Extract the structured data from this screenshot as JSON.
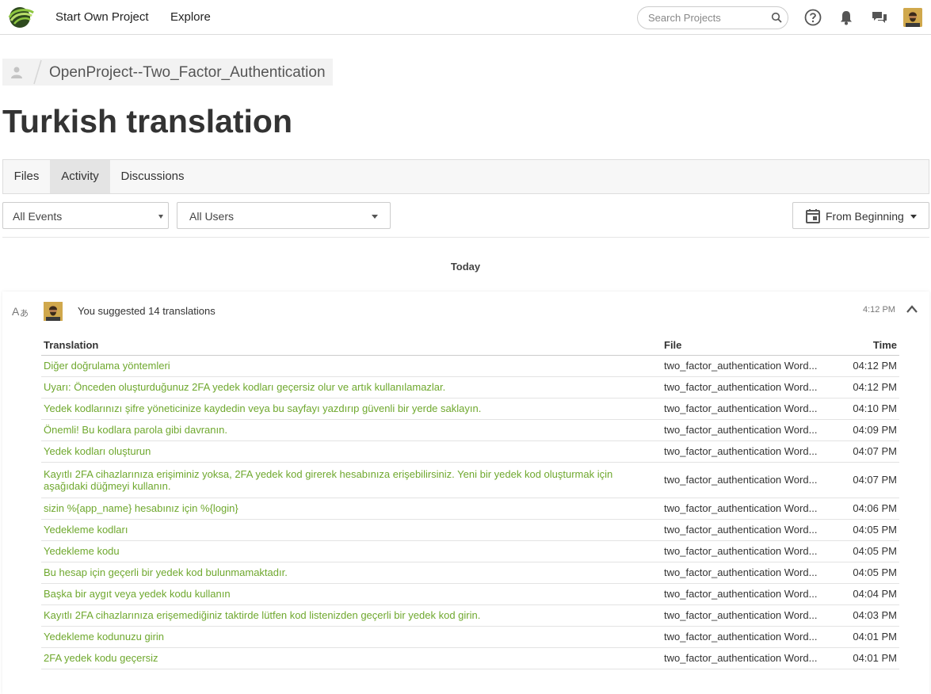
{
  "nav": {
    "start_project": "Start Own Project",
    "explore": "Explore",
    "search_placeholder": "Search Projects"
  },
  "breadcrumb": {
    "project": "OpenProject--Two_Factor_Authentication"
  },
  "page_title": "Turkish translation",
  "tabs": [
    "Files",
    "Activity",
    "Discussions"
  ],
  "filters": {
    "events": "All Events",
    "users": "All Users",
    "date": "From Beginning"
  },
  "day_label": "Today",
  "activity": {
    "summary": "You suggested 14 translations",
    "time": "4:12 PM",
    "columns": {
      "translation": "Translation",
      "file": "File",
      "time": "Time"
    },
    "rows": [
      {
        "text": "Diğer doğrulama yöntemleri",
        "file": "two_factor_authentication Word...",
        "time": "04:12 PM"
      },
      {
        "text": "Uyarı: Önceden oluşturduğunuz 2FA yedek kodları geçersiz olur ve artık kullanılamazlar.",
        "file": "two_factor_authentication Word...",
        "time": "04:12 PM"
      },
      {
        "text": "Yedek kodlarınızı şifre yöneticinize kaydedin veya bu sayfayı yazdırıp güvenli bir yerde saklayın.",
        "file": "two_factor_authentication Word...",
        "time": "04:10 PM"
      },
      {
        "text": "Önemli! Bu kodlara parola gibi davranın.",
        "file": "two_factor_authentication Word...",
        "time": "04:09 PM"
      },
      {
        "text": "Yedek kodları oluşturun",
        "file": "two_factor_authentication Word...",
        "time": "04:07 PM"
      },
      {
        "text": "Kayıtlı 2FA cihazlarınıza erişiminiz yoksa, 2FA yedek kod girerek hesabınıza erişebilirsiniz. Yeni bir yedek kod oluşturmak için aşağıdaki düğmeyi kullanın.",
        "file": "two_factor_authentication Word...",
        "time": "04:07 PM"
      },
      {
        "text": "sizin %{app_name} hesabınız için %{login}",
        "file": "two_factor_authentication Word...",
        "time": "04:06 PM"
      },
      {
        "text": "Yedekleme kodları",
        "file": "two_factor_authentication Word...",
        "time": "04:05 PM"
      },
      {
        "text": "Yedekleme kodu",
        "file": "two_factor_authentication Word...",
        "time": "04:05 PM"
      },
      {
        "text": "Bu hesap için geçerli bir yedek kod bulunmamaktadır.",
        "file": "two_factor_authentication Word...",
        "time": "04:05 PM"
      },
      {
        "text": "Başka bir aygıt veya yedek kodu kullanın",
        "file": "two_factor_authentication Word...",
        "time": "04:04 PM"
      },
      {
        "text": "Kayıtlı 2FA cihazlarınıza erişemediğiniz taktirde lütfen kod listenizden geçerli bir yedek kod girin.",
        "file": "two_factor_authentication Word...",
        "time": "04:03 PM"
      },
      {
        "text": "Yedekleme kodunuzu girin",
        "file": "two_factor_authentication Word...",
        "time": "04:01 PM"
      },
      {
        "text": "2FA yedek kodu geçersiz",
        "file": "two_factor_authentication Word...",
        "time": "04:01 PM"
      }
    ]
  },
  "colors": {
    "link_green": "#6fa82e",
    "brand_green": "#8dc63f",
    "icon_gray": "#555555"
  }
}
